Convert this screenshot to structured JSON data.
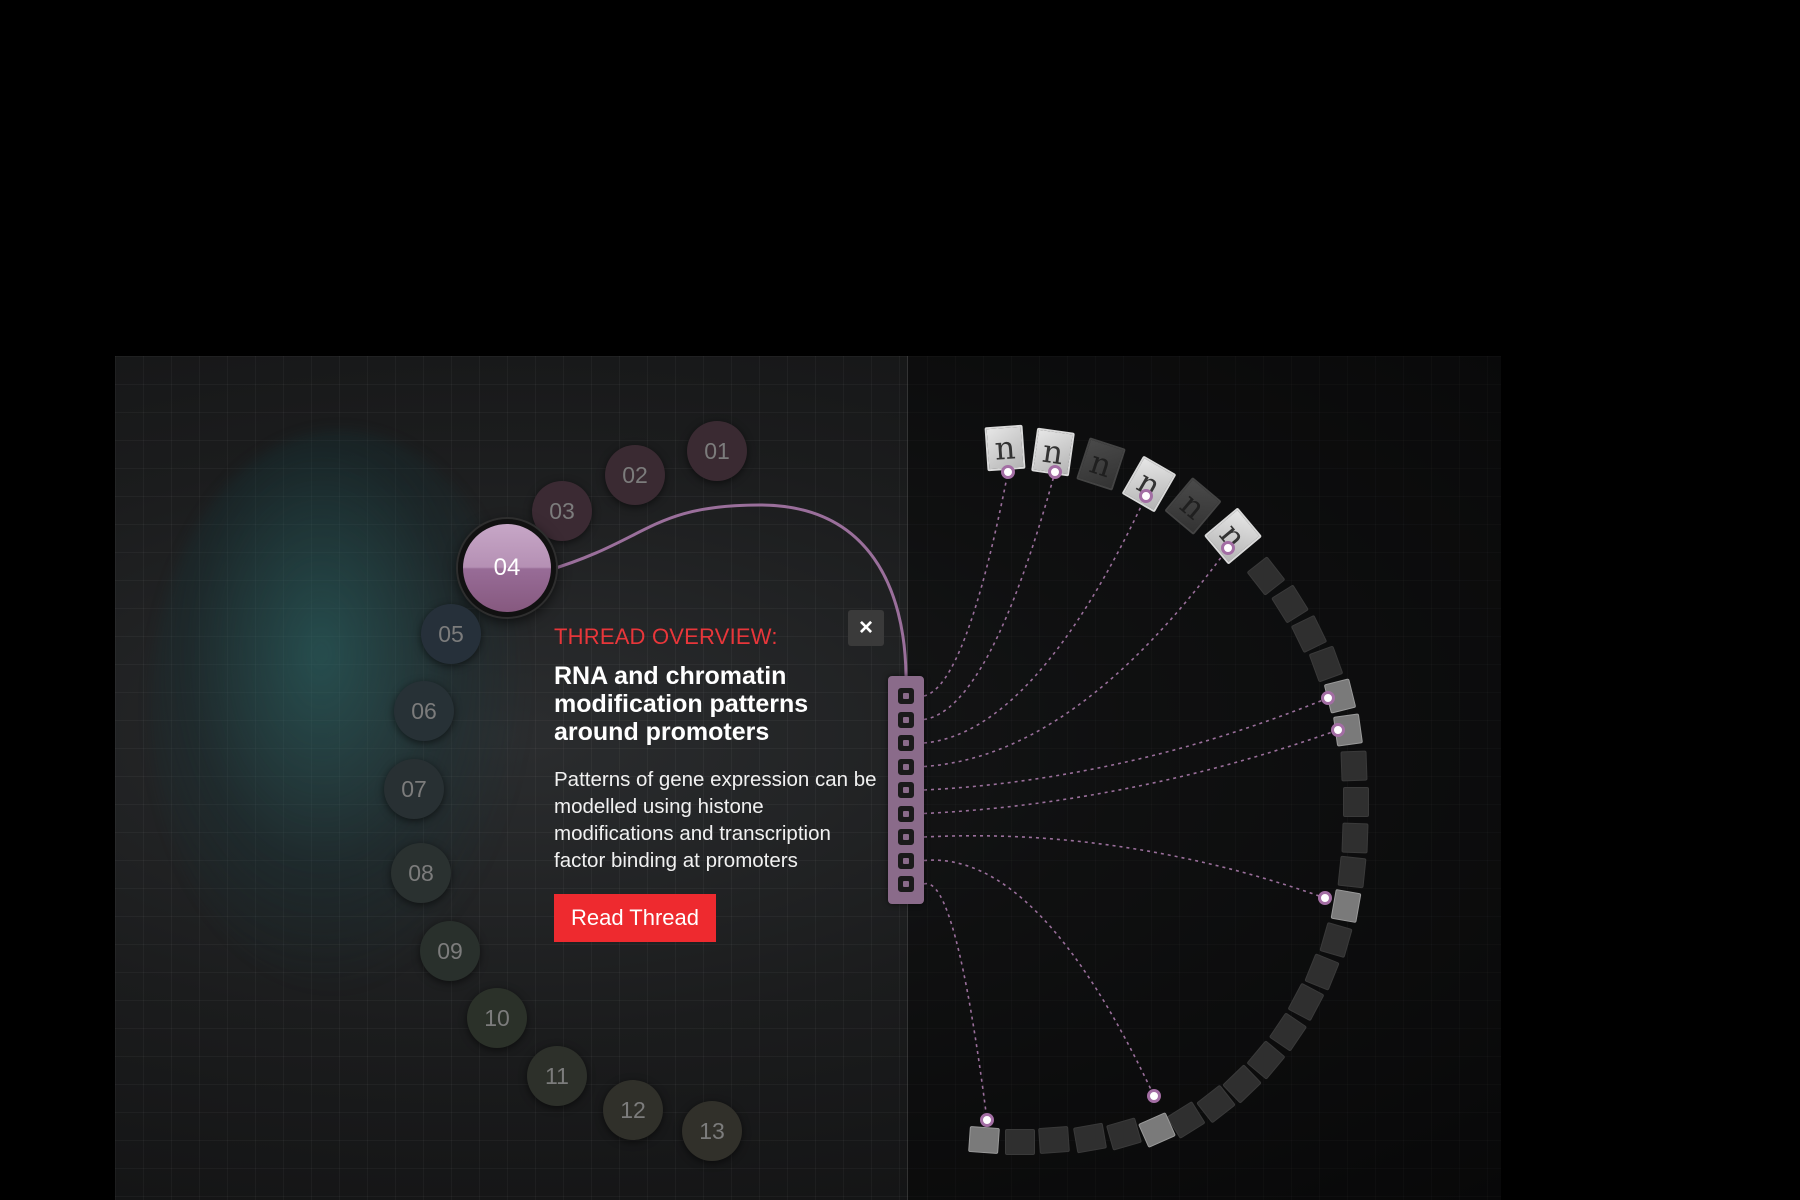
{
  "thread_circles": [
    {
      "label": "01",
      "active": false
    },
    {
      "label": "02",
      "active": false
    },
    {
      "label": "03",
      "active": false
    },
    {
      "label": "04",
      "active": true
    },
    {
      "label": "05",
      "active": false
    },
    {
      "label": "06",
      "active": false
    },
    {
      "label": "07",
      "active": false
    },
    {
      "label": "08",
      "active": false
    },
    {
      "label": "09",
      "active": false
    },
    {
      "label": "10",
      "active": false
    },
    {
      "label": "11",
      "active": false
    },
    {
      "label": "12",
      "active": false
    },
    {
      "label": "13",
      "active": false
    }
  ],
  "overview": {
    "kicker": "THREAD OVERVIEW:",
    "title": "RNA and chromatin modification patterns around promoters",
    "description": "Patterns of gene expression can be modelled using histone modifications and transcription factor binding at promoters",
    "read_button": "Read Thread",
    "close_icon": "×"
  },
  "doc_glyph": "n",
  "colors": {
    "accent_red": "#ee2a2f",
    "thread_purple": "#a36ea4",
    "active_circle": "#b590b4"
  },
  "icons": [
    "close-icon",
    "journal-document-icon",
    "document-icon",
    "connector-pin-icon"
  ]
}
